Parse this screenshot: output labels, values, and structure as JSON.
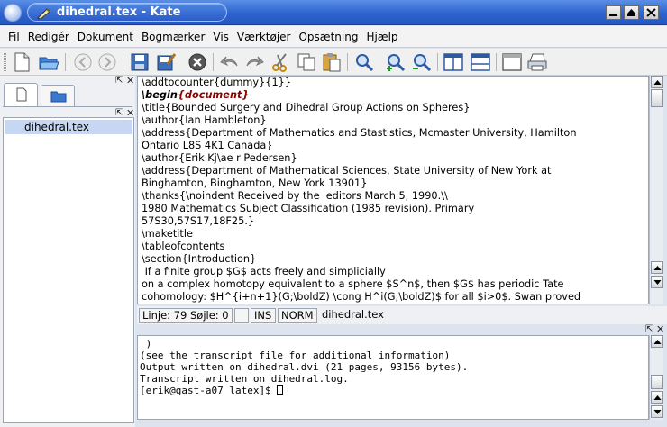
{
  "window": {
    "title": "dihedral.tex - Kate"
  },
  "menu": [
    "Fil",
    "Redigér",
    "Dokument",
    "Bogmærker",
    "Vis",
    "Værktøjer",
    "Opsætning",
    "Hjælp"
  ],
  "toolbar": {
    "icons": [
      "new-document-icon",
      "open-folder-icon",
      "back-arrow-icon",
      "forward-arrow-icon",
      "save-icon",
      "save-as-icon",
      "close-document-icon",
      "undo-icon",
      "redo-icon",
      "cut-icon",
      "copy-icon",
      "paste-icon",
      "find-icon",
      "zoom-in-icon",
      "zoom-out-icon",
      "split-vertical-icon",
      "split-horizontal-icon",
      "window-icon",
      "print-icon"
    ]
  },
  "sidebar": {
    "files": [
      "dihedral.tex"
    ]
  },
  "editor": {
    "lines": [
      "\\addtocounter{dummy}{1}}",
      "",
      "\\title{Bounded Surgery and Dihedral Group Actions on Spheres}",
      "\\author{Ian Hambleton}",
      "\\address{Department of Mathematics and Stastistics, Mcmaster University, Hamilton",
      "Ontario L8S 4K1 Canada}",
      "\\author{Erik Kj\\ae r Pedersen}",
      "\\address{Department of Mathematical Sciences, State University of New York at",
      "Binghamton, Binghamton, New York 13901}",
      "\\thanks{\\noindent Received by the  editors March 5, 1990.\\\\",
      "1980 Mathematics Subject Classification (1985 revision). Primary",
      "57S30,57S17,18F25.}",
      "\\maketitle",
      "\\tableofcontents",
      "\\section{Introduction}",
      " If a finite group $G$ acts freely and simplicially",
      "on a complex homotopy equivalent to a sphere $S^n$, then $G$ has periodic Tate",
      "cohomology: $H^{i+n+1}(G;\\boldZ) \\cong H^i(G;\\boldZ)$ for all $i>0$. Swan proved"
    ],
    "begin_keyword": "\\begin",
    "begin_argument": "{document}"
  },
  "statusbar": {
    "position": "Linje: 79 Søjle: 0",
    "insert_mode": "INS",
    "edit_mode": "NORM",
    "filename": "dihedral.tex"
  },
  "terminal": {
    "lines": [
      " )",
      "(see the transcript file for additional information)",
      "Output written on dihedral.dvi (21 pages, 93156 bytes).",
      "Transcript written on dihedral.log.",
      "[erik@gast-a07 latex]$ "
    ]
  },
  "colors": {
    "titlebar": "#2d63cf",
    "selection": "#c6d6f3",
    "keyword_red": "#8b0000"
  }
}
